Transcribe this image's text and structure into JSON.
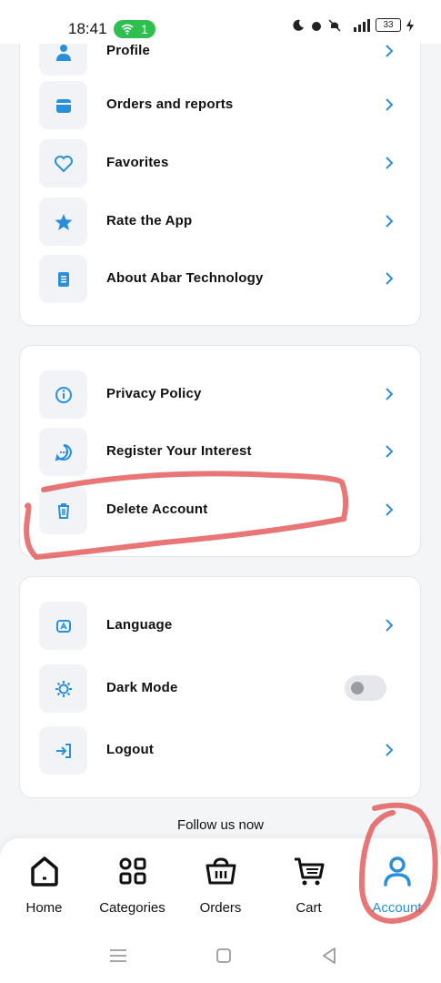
{
  "status": {
    "time": "18:41",
    "wifi_count": "1",
    "battery": "33"
  },
  "group1": [
    {
      "label": "Profile",
      "icon": "user-icon"
    },
    {
      "label": "Orders and reports",
      "icon": "wallet-icon"
    },
    {
      "label": "Favorites",
      "icon": "heart-icon"
    },
    {
      "label": "Rate the App",
      "icon": "star-icon"
    },
    {
      "label": "About Abar Technology",
      "icon": "document-icon"
    }
  ],
  "group2": [
    {
      "label": "Privacy Policy",
      "icon": "info-icon"
    },
    {
      "label": "Register Your Interest",
      "icon": "chat-icon"
    },
    {
      "label": "Delete Account",
      "icon": "trash-icon"
    }
  ],
  "group3": [
    {
      "label": "Language",
      "icon": "translate-icon"
    },
    {
      "label": "Dark Mode",
      "icon": "sun-icon",
      "toggle": false
    },
    {
      "label": "Logout",
      "icon": "logout-icon"
    }
  ],
  "follow_text": "Follow us now",
  "nav": [
    {
      "label": "Home",
      "icon": "home-icon"
    },
    {
      "label": "Categories",
      "icon": "categories-icon"
    },
    {
      "label": "Orders",
      "icon": "basket-icon"
    },
    {
      "label": "Cart",
      "icon": "cart-icon"
    },
    {
      "label": "Account",
      "icon": "account-icon",
      "active": true
    }
  ],
  "colors": {
    "accent": "#2a8fdb",
    "annotation": "#e0484a"
  }
}
